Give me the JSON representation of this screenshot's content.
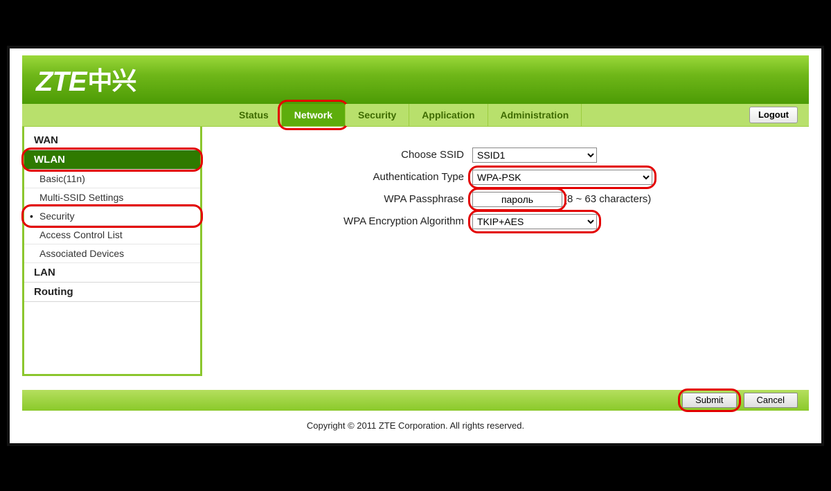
{
  "logo": {
    "brand": "ZTE",
    "cn": "中兴"
  },
  "nav": {
    "tabs": [
      {
        "id": "status",
        "label": "Status"
      },
      {
        "id": "network",
        "label": "Network"
      },
      {
        "id": "security",
        "label": "Security"
      },
      {
        "id": "application",
        "label": "Application"
      },
      {
        "id": "administration",
        "label": "Administration"
      }
    ],
    "active": "network",
    "logout": "Logout"
  },
  "sidebar": {
    "items": [
      {
        "id": "wan",
        "label": "WAN",
        "type": "section"
      },
      {
        "id": "wlan",
        "label": "WLAN",
        "type": "section",
        "active": true
      },
      {
        "id": "basic",
        "label": "Basic(11n)",
        "type": "sub"
      },
      {
        "id": "multissid",
        "label": "Multi-SSID Settings",
        "type": "sub"
      },
      {
        "id": "security",
        "label": "Security",
        "type": "sub",
        "current": true
      },
      {
        "id": "acl",
        "label": "Access Control List",
        "type": "sub"
      },
      {
        "id": "assoc",
        "label": "Associated Devices",
        "type": "sub"
      },
      {
        "id": "lan",
        "label": "LAN",
        "type": "section"
      },
      {
        "id": "routing",
        "label": "Routing",
        "type": "section"
      }
    ]
  },
  "form": {
    "ssid_label": "Choose SSID",
    "ssid_value": "SSID1",
    "auth_label": "Authentication Type",
    "auth_value": "WPA-PSK",
    "pass_label": "WPA Passphrase",
    "pass_value": "пароль",
    "pass_hint": "(8 ~ 63 characters)",
    "enc_label": "WPA Encryption Algorithm",
    "enc_value": "TKIP+AES"
  },
  "actions": {
    "submit": "Submit",
    "cancel": "Cancel"
  },
  "footer": "Copyright © 2011 ZTE Corporation. All rights reserved."
}
